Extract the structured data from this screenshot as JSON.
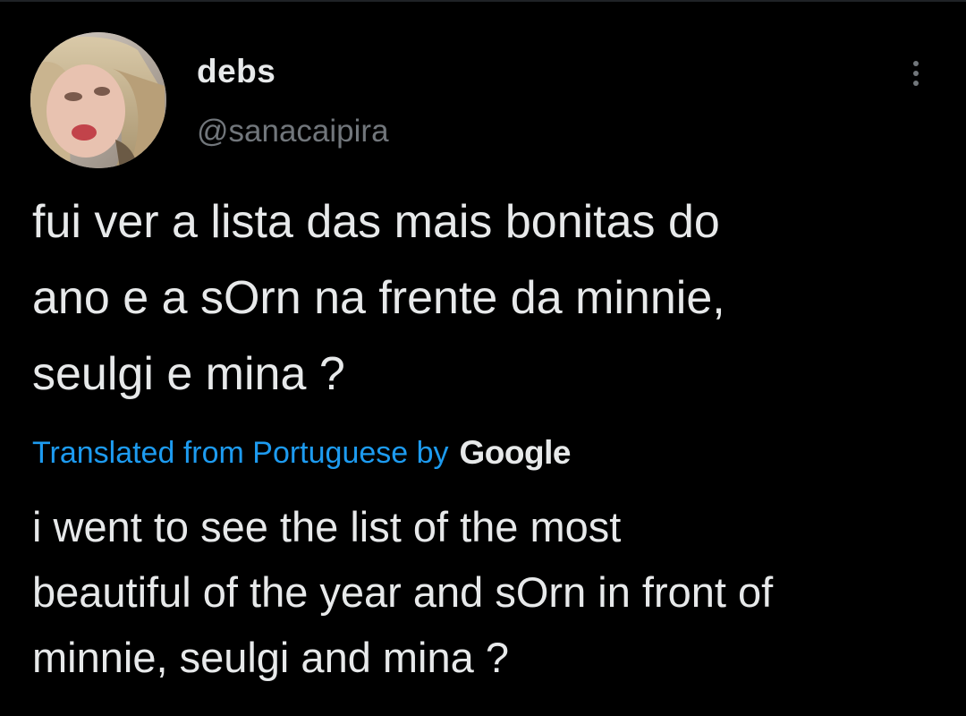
{
  "tweet": {
    "author": {
      "display_name": "debs",
      "handle": "@sanacaipira",
      "avatar_icon": "user-avatar-photo"
    },
    "more_icon": "more-vertical-icon",
    "text": "fui ver a lista das mais bonitas do\nano e a sOrn na frente da minnie,\nseulgi e mina ?",
    "translation": {
      "label": "Translated from Portuguese by",
      "provider": "Google",
      "text": "i went to see the list of the most\nbeautiful of the year and sOrn in front of\nminnie, seulgi and mina ?"
    }
  },
  "colors": {
    "background": "#000000",
    "primary_text": "#e7e9ea",
    "secondary_text": "#71767b",
    "link": "#1d9bf0"
  }
}
